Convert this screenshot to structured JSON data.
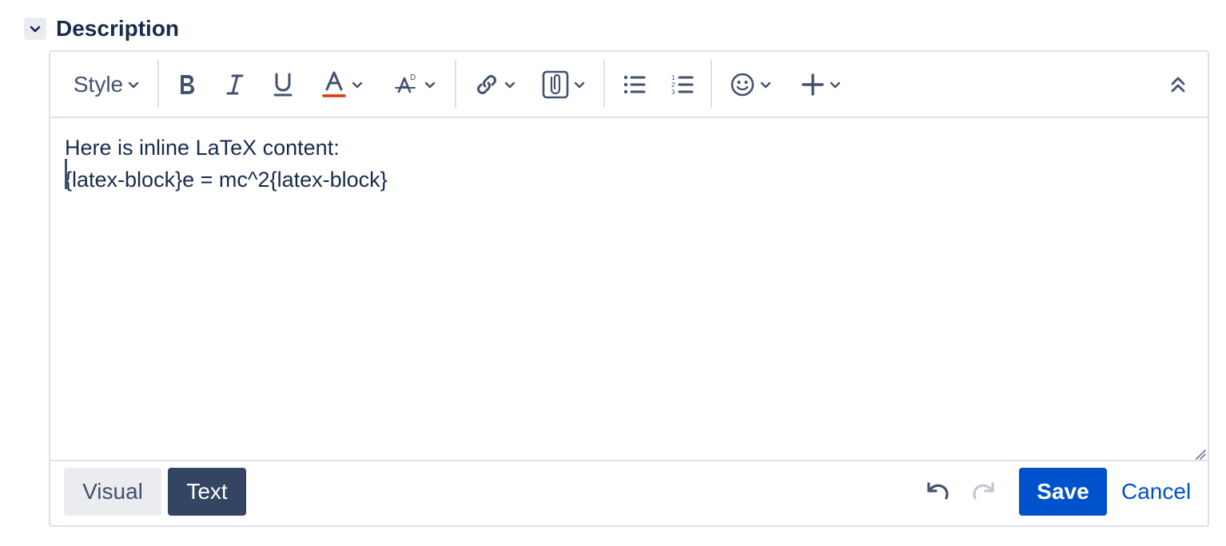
{
  "section": {
    "title": "Description"
  },
  "toolbar": {
    "style_label": "Style",
    "icons": [
      "bold-icon",
      "italic-icon",
      "underline-icon",
      "text-color-icon",
      "clear-format-icon",
      "link-icon",
      "attachment-icon",
      "bullet-list-icon",
      "numbered-list-icon",
      "emoji-icon",
      "insert-icon",
      "collapse-toolbar-icon"
    ],
    "text_color_underline": "#de350b"
  },
  "content": {
    "lines": [
      "Here is inline LaTeX content:",
      "{latex-block}e = mc^2{latex-block}"
    ]
  },
  "footer": {
    "visual_label": "Visual",
    "text_label": "Text",
    "save_label": "Save",
    "cancel_label": "Cancel"
  },
  "colors": {
    "primary": "#0052cc",
    "text_mode_active": "#344563",
    "text": "#172b4d"
  }
}
